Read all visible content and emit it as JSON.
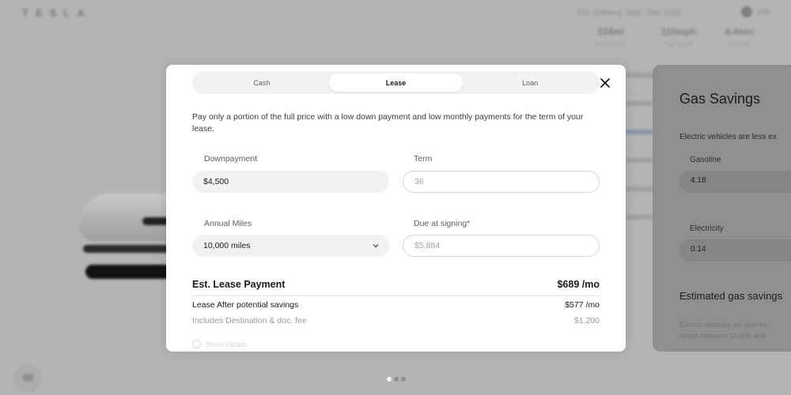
{
  "background": {
    "brand": "TESLA",
    "delivery": "Est. Delivery: Sep - Dec 2022",
    "locale": "US",
    "specs": [
      {
        "value": "334mi",
        "label": "Range (est.)"
      },
      {
        "value": "110mph",
        "label": "Top Speed"
      },
      {
        "value": "4.4sec",
        "label": "0-60 mph"
      }
    ],
    "carousel": {
      "count": 3,
      "active_index": 0
    }
  },
  "modal": {
    "tabs": [
      {
        "label": "Cash",
        "active": false
      },
      {
        "label": "Lease",
        "active": true
      },
      {
        "label": "Loan",
        "active": false
      }
    ],
    "close_icon": "close-icon",
    "description": "Pay only a portion of the full price with a low down payment and low monthly payments for the term of your lease.",
    "fields": {
      "downpayment": {
        "label": "Downpayment",
        "value": "$4,500"
      },
      "term": {
        "label": "Term",
        "value": "36"
      },
      "annual_miles": {
        "label": "Annual Miles",
        "value": "10,000 miles"
      },
      "due_at_signing": {
        "label": "Due at signing*",
        "value": "$5,884"
      }
    },
    "summary": {
      "est_label": "Est. Lease Payment",
      "est_value": "$689 /mo",
      "after_label": "Lease After potential savings",
      "after_value": "$577 /mo",
      "fee_label": "Includes Destination & doc. fee",
      "fee_value": "$1,200"
    },
    "show_details": "Show Details"
  },
  "gas_panel": {
    "title": "Gas Savings",
    "intro": "Electric vehicles are less ex",
    "gasoline": {
      "label": "Gasoline",
      "value": "4.18"
    },
    "electricity": {
      "label": "Electricity",
      "value": "0.14"
    },
    "estimated_title": "Estimated gas savings",
    "fine_print": [
      "Electric vehicles are less ex",
      "drives between 10,000 and"
    ]
  }
}
